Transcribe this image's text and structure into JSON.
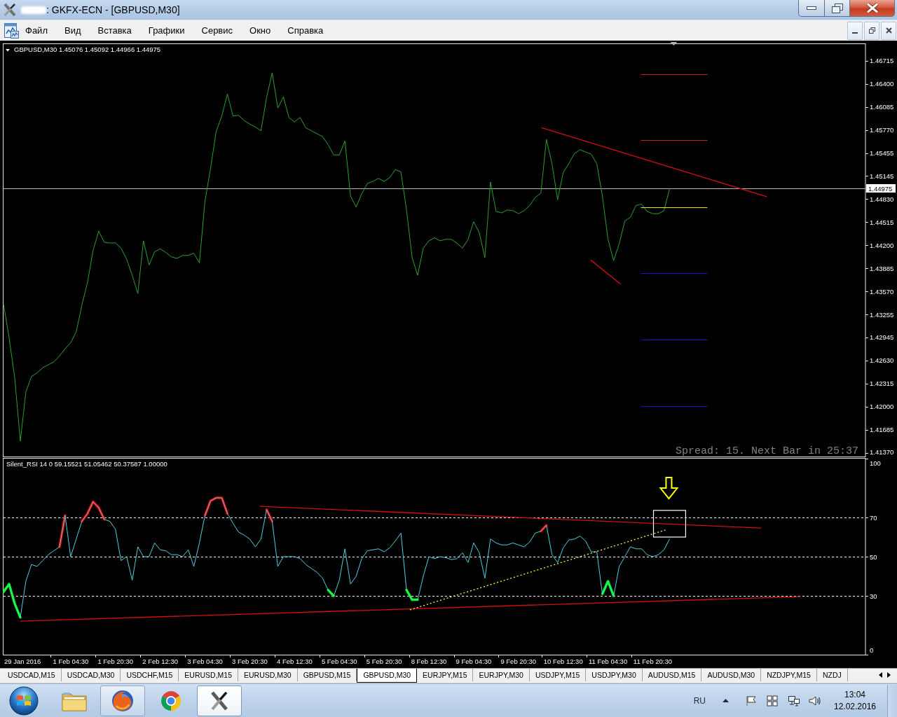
{
  "window": {
    "title": ": GKFX-ECN - [GBPUSD,M30]"
  },
  "menu": [
    "Файл",
    "Вид",
    "Вставка",
    "Графики",
    "Сервис",
    "Окно",
    "Справка"
  ],
  "price_chart": {
    "legend": "GBPUSD,M30  1.45076 1.45092 1.44966 1.44975",
    "spread_info": "Spread: 15. Next Bar in 25:37",
    "chart_data": {
      "type": "line",
      "ylim": [
        1.4132,
        1.4694
      ],
      "yticks": [
        1.46715,
        {
          "value": 1.464,
          "label": "1.46400"
        },
        1.46085,
        {
          "value": 1.4577,
          "label": "1.45770"
        },
        1.45455,
        1.45145,
        {
          "value": 1.4483,
          "label": "1.44830"
        },
        1.44515,
        {
          "value": 1.442,
          "label": "1.44200"
        },
        1.43885,
        {
          "value": 1.4357,
          "label": "1.43570"
        },
        1.43255,
        1.42945,
        {
          "value": 1.4263,
          "label": "1.42630"
        },
        1.42315,
        {
          "value": 1.42,
          "label": "1.42000"
        },
        1.41685,
        {
          "value": 1.4137,
          "label": "1.41370"
        }
      ],
      "categories": [
        null,
        null,
        null,
        null,
        null,
        null,
        null,
        null,
        null,
        null,
        null,
        null,
        null,
        null,
        null,
        null,
        null,
        null,
        null,
        null,
        null,
        null,
        null,
        null,
        null,
        null,
        null,
        null,
        null,
        null,
        null,
        null,
        null,
        null,
        null,
        null,
        null,
        null,
        null,
        null,
        null,
        null,
        null,
        null,
        null,
        null,
        null,
        null,
        null,
        null,
        null,
        null,
        null,
        null,
        null,
        null,
        null,
        null,
        null,
        null,
        null,
        null,
        null,
        null,
        null,
        null,
        null,
        null,
        null,
        null,
        null,
        null,
        null,
        null,
        null,
        null,
        null,
        null,
        null,
        null,
        null,
        null,
        null,
        null,
        null,
        null,
        null,
        null,
        null,
        null,
        null,
        null,
        null,
        null,
        null,
        null,
        null,
        null,
        null,
        null,
        null,
        null,
        null,
        null,
        null,
        null,
        null,
        null,
        null,
        null,
        null,
        null,
        null,
        null,
        null,
        null,
        null,
        null,
        null,
        null,
        null,
        null,
        null,
        null,
        null,
        null,
        null,
        null,
        null,
        null,
        null,
        null,
        null,
        null,
        null,
        null,
        null,
        null,
        null,
        null,
        null,
        null,
        null,
        null,
        null,
        null,
        null,
        null,
        null,
        null,
        null,
        null,
        null,
        null
      ],
      "series": [
        {
          "color": "#2ca02c",
          "values": [
            1.434,
            1.4294,
            1.4239,
            1.4153,
            1.422,
            1.4241,
            1.4246,
            1.4253,
            1.4257,
            1.4261,
            1.4269,
            1.4279,
            1.4287,
            1.4302,
            1.4338,
            1.4369,
            1.4413,
            1.4439,
            1.4424,
            1.4423,
            1.4423,
            1.4416,
            1.4401,
            1.4379,
            1.4354,
            1.4426,
            1.4393,
            1.4411,
            1.4415,
            1.441,
            1.4404,
            1.4402,
            1.4406,
            1.4406,
            1.4409,
            1.4396,
            1.448,
            1.4525,
            1.4575,
            1.4596,
            1.4626,
            1.4596,
            1.4597,
            1.459,
            1.4585,
            1.4581,
            1.4576,
            1.4621,
            1.4655,
            1.4607,
            1.4622,
            1.4594,
            1.4588,
            1.4594,
            1.458,
            1.4576,
            1.4572,
            1.4568,
            1.4557,
            1.4543,
            1.4543,
            1.4562,
            1.4487,
            1.4472,
            1.449,
            1.4504,
            1.4507,
            1.4511,
            1.4507,
            1.4512,
            1.4523,
            1.452,
            1.4468,
            1.4403,
            1.4379,
            1.4416,
            1.4426,
            1.443,
            1.4426,
            1.4428,
            1.4428,
            1.4423,
            1.4416,
            1.4428,
            1.4452,
            1.4437,
            1.4403,
            1.4506,
            1.4466,
            1.4464,
            1.4468,
            1.4467,
            1.4463,
            1.4467,
            1.4474,
            1.4485,
            1.4491,
            1.4564,
            1.4531,
            1.4482,
            1.4519,
            1.4531,
            1.4545,
            1.455,
            1.4547,
            1.4544,
            1.4531,
            1.4487,
            1.4428,
            1.4399,
            1.4422,
            1.4453,
            1.4458,
            1.4474,
            1.4476,
            1.4466,
            1.4463,
            1.4463,
            1.4467,
            1.4497,
            null,
            null,
            null,
            null,
            null,
            null,
            null,
            null,
            null,
            null,
            null,
            null,
            null,
            null,
            null,
            null,
            null,
            null,
            null,
            null,
            null,
            null,
            null,
            null,
            null,
            null,
            null,
            null,
            null,
            null,
            null,
            null,
            null,
            null
          ]
        }
      ],
      "ref_lines": [
        {
          "axis": "y",
          "value": 1.44975,
          "label": "1.44975"
        }
      ]
    }
  },
  "indicator_chart": {
    "legend": "Silent_RSI 14 0 59.15521 51.05462 50.37587 1.00000",
    "chart_data": {
      "type": "line",
      "ylim": [
        0,
        100
      ],
      "yticks": [
        100,
        70,
        50,
        30,
        0
      ],
      "categories": [
        null,
        null,
        null,
        "29 Jan 2016",
        null,
        null,
        null,
        null,
        null,
        null,
        null,
        null,
        "1 Feb 04:30",
        null,
        null,
        null,
        null,
        null,
        null,
        null,
        "1 Feb 20:30",
        null,
        null,
        null,
        null,
        null,
        null,
        null,
        "2 Feb 12:30",
        null,
        null,
        null,
        null,
        null,
        null,
        null,
        "3 Feb 04:30",
        null,
        null,
        null,
        null,
        null,
        null,
        null,
        "3 Feb 20:30",
        null,
        null,
        null,
        null,
        null,
        null,
        null,
        "4 Feb 12:30",
        null,
        null,
        null,
        null,
        null,
        null,
        null,
        "5 Feb 04:30",
        null,
        null,
        null,
        null,
        null,
        null,
        null,
        "5 Feb 20:30",
        null,
        null,
        null,
        null,
        null,
        null,
        null,
        "8 Feb 12:30",
        null,
        null,
        null,
        null,
        null,
        null,
        null,
        "9 Feb 04:30",
        null,
        null,
        null,
        null,
        null,
        null,
        null,
        "9 Feb 20:30",
        null,
        null,
        null,
        null,
        null,
        null,
        null,
        "10 Feb 12:30",
        null,
        null,
        null,
        null,
        null,
        null,
        null,
        "11 Feb 04:30",
        null,
        null,
        null,
        null,
        null,
        null,
        null,
        "11 Feb 20:30",
        null,
        null,
        null,
        null,
        null,
        null,
        null,
        null,
        null,
        null,
        null,
        null,
        null,
        null,
        null,
        null,
        null,
        null,
        null,
        null,
        null,
        null,
        null,
        null,
        null,
        null,
        null,
        null,
        null,
        null,
        null,
        null,
        null,
        null,
        null,
        null,
        null
      ],
      "series": [
        {
          "color": "#4fd0e0",
          "values": [
            32,
            36,
            26,
            19,
            37.5,
            46,
            45,
            48,
            51,
            53,
            55,
            71,
            50,
            59,
            68,
            72,
            78,
            75,
            69,
            68,
            64,
            48,
            50,
            38,
            55,
            50,
            50,
            57,
            53.5,
            53,
            51,
            51,
            50,
            53.5,
            45,
            57,
            71,
            78.5,
            80,
            80,
            72,
            67,
            62.5,
            61,
            59,
            55,
            59,
            74,
            68,
            45,
            50,
            50,
            50,
            49,
            46,
            44,
            42,
            39,
            33,
            30,
            38,
            54,
            36,
            40,
            49,
            53,
            53.5,
            54,
            52.5,
            54.5,
            58,
            62,
            33,
            28,
            28,
            40,
            50,
            49,
            50,
            49.5,
            48.5,
            49,
            52,
            47,
            57,
            52,
            39,
            59,
            57,
            56,
            56,
            57,
            56,
            55,
            57.5,
            62,
            63,
            66,
            51,
            47,
            54.5,
            58.5,
            59,
            60.5,
            58,
            52.5,
            52.5,
            31,
            37.5,
            30,
            45,
            50,
            55,
            54,
            54,
            51,
            50,
            51,
            53.5,
            59,
            null,
            null,
            null,
            null,
            null,
            null,
            null,
            null,
            null,
            null,
            null,
            null,
            null,
            null,
            null,
            null,
            null,
            null,
            null,
            null,
            null,
            null,
            null,
            null,
            null,
            null,
            null,
            null,
            null,
            null,
            null,
            null,
            null,
            null
          ]
        },
        {
          "color": "#ff0000",
          "values": [
            null,
            null,
            null,
            null,
            null,
            null,
            null,
            null,
            null,
            null,
            55,
            71,
            null,
            null,
            68,
            72,
            78,
            75,
            69,
            null,
            null,
            null,
            null,
            null,
            null,
            null,
            null,
            null,
            null,
            null,
            null,
            null,
            null,
            null,
            null,
            null,
            71,
            78.5,
            80,
            80,
            72,
            null,
            null,
            null,
            null,
            null,
            null,
            74,
            68,
            null,
            null,
            null,
            null,
            null,
            null,
            null,
            null,
            null,
            null,
            null,
            null,
            null,
            null,
            null,
            null,
            null,
            null,
            null,
            null,
            null,
            null,
            null,
            null,
            null,
            null,
            null,
            null,
            null,
            null,
            null,
            null,
            null,
            null,
            null,
            null,
            null,
            null,
            null,
            null,
            null,
            null,
            null,
            null,
            null,
            null,
            null,
            63,
            66,
            null,
            null,
            null,
            null,
            null,
            null,
            null,
            null,
            null,
            null,
            null,
            null,
            null,
            null,
            null,
            null,
            null,
            null,
            null,
            null,
            null,
            null,
            null,
            null,
            null,
            null,
            null,
            null,
            null,
            null,
            null,
            null,
            null,
            null,
            null,
            null,
            null,
            null,
            null,
            null,
            null,
            null,
            null,
            null,
            null,
            null,
            null,
            null,
            null,
            null,
            null,
            null,
            null,
            null,
            null,
            null
          ]
        },
        {
          "color": "#00ff00",
          "values": [
            32,
            36,
            26,
            19,
            null,
            null,
            null,
            null,
            null,
            null,
            null,
            null,
            null,
            null,
            null,
            null,
            null,
            null,
            null,
            null,
            null,
            null,
            null,
            null,
            null,
            null,
            null,
            null,
            null,
            null,
            null,
            null,
            null,
            null,
            null,
            null,
            null,
            null,
            null,
            null,
            null,
            null,
            null,
            null,
            null,
            null,
            null,
            null,
            null,
            null,
            null,
            null,
            null,
            null,
            null,
            null,
            null,
            null,
            33,
            30,
            null,
            null,
            null,
            null,
            null,
            null,
            null,
            null,
            null,
            null,
            null,
            null,
            33,
            28,
            28,
            null,
            null,
            null,
            null,
            null,
            null,
            null,
            null,
            null,
            null,
            null,
            null,
            null,
            null,
            null,
            null,
            null,
            null,
            null,
            null,
            null,
            null,
            null,
            null,
            null,
            null,
            null,
            null,
            null,
            null,
            null,
            null,
            31,
            37.5,
            30,
            null,
            null,
            null,
            null,
            null,
            null,
            null,
            null,
            null,
            null,
            null,
            null,
            null,
            null,
            null,
            null,
            null,
            null,
            null,
            null,
            null,
            null,
            null,
            null,
            null,
            null,
            null,
            null,
            null,
            null,
            null,
            null,
            null,
            null,
            null,
            null,
            null,
            null,
            null,
            null,
            null,
            null,
            null,
            null
          ]
        }
      ],
      "ref_lines": [
        {
          "axis": "y",
          "value": 70
        },
        {
          "axis": "y",
          "value": 50
        },
        {
          "axis": "y",
          "value": 30
        }
      ]
    }
  },
  "chart_tabs": [
    {
      "label": "USDCAD,M15",
      "selected": false
    },
    {
      "label": "USDCAD,M30",
      "selected": false
    },
    {
      "label": "USDCHF,M15",
      "selected": false
    },
    {
      "label": "EURUSD,M15",
      "selected": false
    },
    {
      "label": "EURUSD,M30",
      "selected": false
    },
    {
      "label": "GBPUSD,M15",
      "selected": false
    },
    {
      "label": "GBPUSD,M30",
      "selected": true
    },
    {
      "label": "EURJPY,M15",
      "selected": false
    },
    {
      "label": "EURJPY,M30",
      "selected": false
    },
    {
      "label": "USDJPY,M15",
      "selected": false
    },
    {
      "label": "USDJPY,M30",
      "selected": false
    },
    {
      "label": "AUDUSD,M15",
      "selected": false
    },
    {
      "label": "AUDUSD,M30",
      "selected": false
    },
    {
      "label": "NZDJPY,M15",
      "selected": false
    },
    {
      "label": "NZDJ",
      "selected": false
    }
  ],
  "taskbar": {
    "apps": [
      {
        "kind": "folder",
        "running": false,
        "selected": false
      },
      {
        "kind": "firefox",
        "running": true,
        "selected": false
      },
      {
        "kind": "chrome",
        "running": false,
        "selected": false
      },
      {
        "kind": "terminal",
        "running": true,
        "selected": true
      }
    ],
    "language": "RU",
    "time": "13:04",
    "date": "12.02.2016"
  }
}
